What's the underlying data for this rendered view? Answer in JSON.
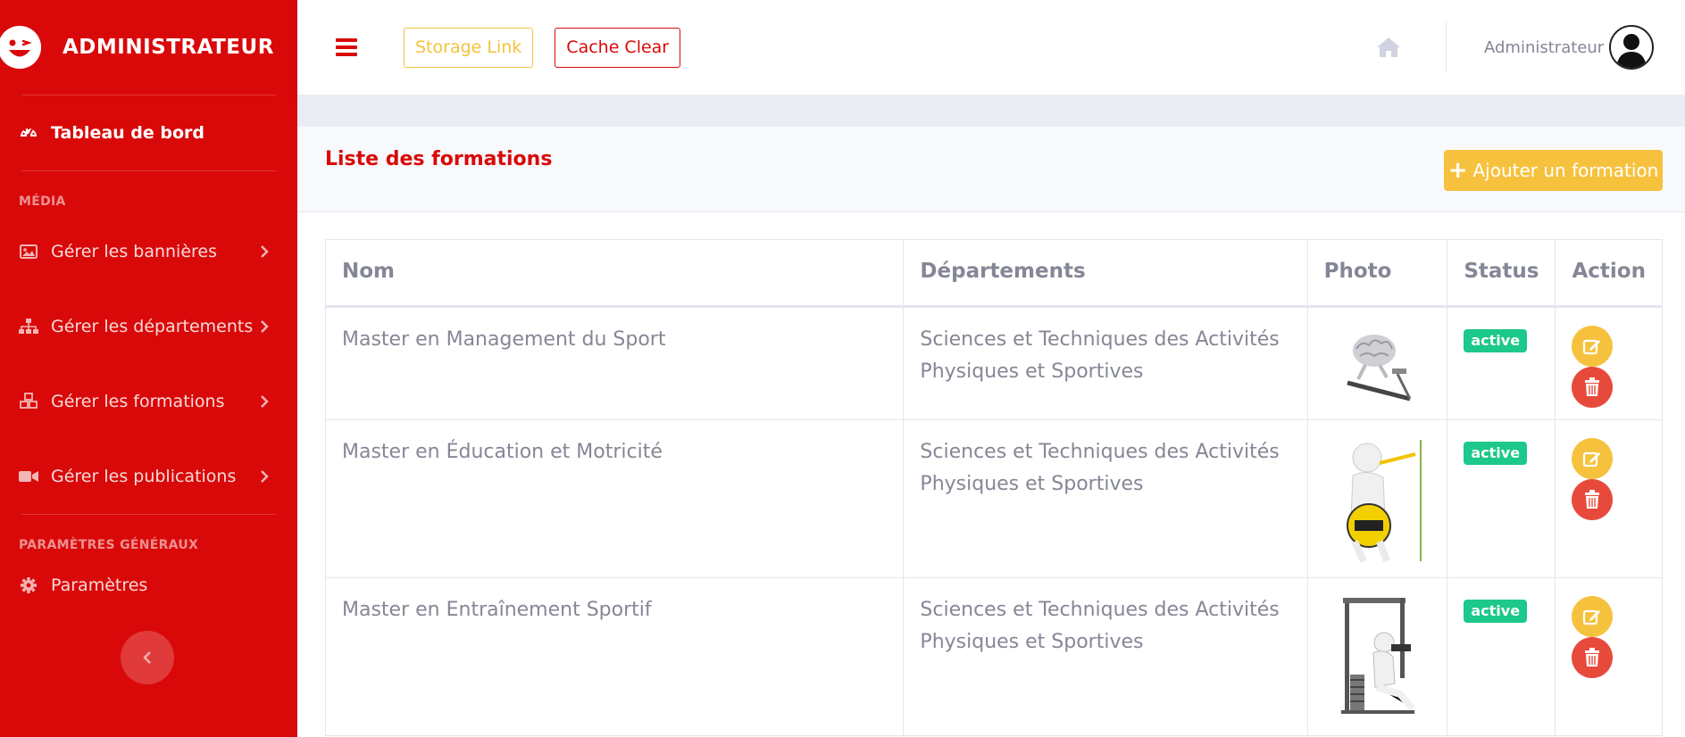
{
  "sidebar": {
    "brand": "ADMINISTRATEUR",
    "dashboard": "Tableau de bord",
    "heading_media": "MÉDIA",
    "items": [
      {
        "label": "Gérer les bannières",
        "icon": "image-icon"
      },
      {
        "label": "Gérer les départements",
        "icon": "sitemap-icon"
      },
      {
        "label": "Gérer les formations",
        "icon": "cubes-icon"
      },
      {
        "label": "Gérer les publications",
        "icon": "video-icon"
      }
    ],
    "heading_settings": "PARAMÈTRES GÉNÉRAUX",
    "settings": "Paramètres"
  },
  "topbar": {
    "storage_label": "Storage Link",
    "cache_label": "Cache Clear",
    "username": "Administrateur"
  },
  "card": {
    "title": "Liste des formations",
    "add_label": "Ajouter un formation"
  },
  "table": {
    "headers": [
      "Nom",
      "Départements",
      "Photo",
      "Status",
      "Action"
    ],
    "rows": [
      {
        "nom": "Master en Management du Sport",
        "departement": "Sciences et Techniques des Activités Physiques et Sportives",
        "status": "active",
        "photo": "brain-on-treadmill"
      },
      {
        "nom": "Master en Éducation et Motricité",
        "departement": "Sciences et Techniques des Activités Physiques et Sportives",
        "status": "active",
        "photo": "figure-with-measuring-tape"
      },
      {
        "nom": "Master en Entraînement Sportif",
        "departement": "Sciences et Techniques des Activités Physiques et Sportives",
        "status": "active",
        "photo": "figure-on-gym-machine"
      }
    ]
  },
  "colors": {
    "primary_red": "#d90909",
    "warning_yellow": "#f6c23e",
    "success_green": "#1cc88a",
    "danger_red": "#e74a3b"
  }
}
